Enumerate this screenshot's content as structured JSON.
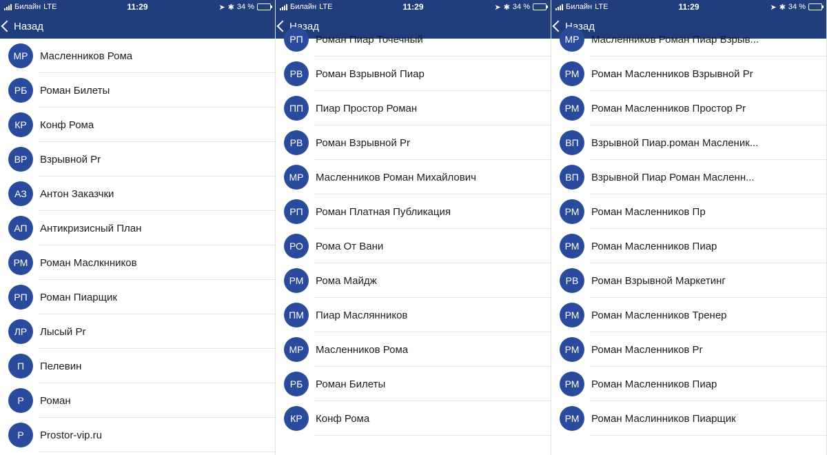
{
  "status": {
    "carrier": "Билайн",
    "network": "LTE",
    "time": "11:29",
    "battery_pct": "34 %",
    "battery_level": 34
  },
  "nav": {
    "back_label": "Назад"
  },
  "screens": [
    {
      "offset": false,
      "contacts": [
        {
          "initials": "МР",
          "name": "Масленников Рома"
        },
        {
          "initials": "РБ",
          "name": "Роман Билеты"
        },
        {
          "initials": "КР",
          "name": "Конф Рома"
        },
        {
          "initials": "ВР",
          "name": "Взрывной Pr"
        },
        {
          "initials": "АЗ",
          "name": "Антон Заказчки"
        },
        {
          "initials": "АП",
          "name": "Антикризисный План"
        },
        {
          "initials": "РМ",
          "name": "Роман Маслкнников"
        },
        {
          "initials": "РП",
          "name": "Роман Пиарщик"
        },
        {
          "initials": "ЛР",
          "name": "Лысый Pr"
        },
        {
          "initials": "П",
          "name": "Пелевин"
        },
        {
          "initials": "Р",
          "name": "Роман"
        },
        {
          "initials": "Р",
          "name": "Prostor-vip.ru"
        }
      ]
    },
    {
      "offset": true,
      "contacts": [
        {
          "initials": "РП",
          "name": "Роман Пиар Точечный"
        },
        {
          "initials": "РВ",
          "name": "Роман Взрывной Пиар"
        },
        {
          "initials": "ПП",
          "name": "Пиар Простор Роман"
        },
        {
          "initials": "РВ",
          "name": "Роман Взрывной Pr"
        },
        {
          "initials": "МР",
          "name": "Масленников Роман Михайлович"
        },
        {
          "initials": "РП",
          "name": "Роман Платная Публикация"
        },
        {
          "initials": "РО",
          "name": "Рома От Вани"
        },
        {
          "initials": "РМ",
          "name": "Рома Майдж"
        },
        {
          "initials": "ПМ",
          "name": "Пиар Маслянников"
        },
        {
          "initials": "МР",
          "name": "Масленников Рома"
        },
        {
          "initials": "РБ",
          "name": "Роман Билеты"
        },
        {
          "initials": "КР",
          "name": "Конф Рома"
        }
      ]
    },
    {
      "offset": true,
      "contacts": [
        {
          "initials": "МР",
          "name": "Масленников Роман Пиар Взрыв..."
        },
        {
          "initials": "РМ",
          "name": "Роман Масленников Взрывной Pr"
        },
        {
          "initials": "РМ",
          "name": "Роман Масленников Простор Pr"
        },
        {
          "initials": "ВП",
          "name": "Взрывной Пиар.роман Масленик..."
        },
        {
          "initials": "ВП",
          "name": "Взрывной Пиар Роман Масленн..."
        },
        {
          "initials": "РМ",
          "name": "Роман Масленников Пр"
        },
        {
          "initials": "РМ",
          "name": "Роман Масленников Пиар"
        },
        {
          "initials": "РВ",
          "name": "Роман Взрывной Маркетинг"
        },
        {
          "initials": "РМ",
          "name": "Роман Масленников Тренер"
        },
        {
          "initials": "РМ",
          "name": "Роман Масленников Pr"
        },
        {
          "initials": "РМ",
          "name": "Роман Масленников Пиар"
        },
        {
          "initials": "РМ",
          "name": "Роман Маслинников Пиарщик"
        }
      ]
    }
  ]
}
